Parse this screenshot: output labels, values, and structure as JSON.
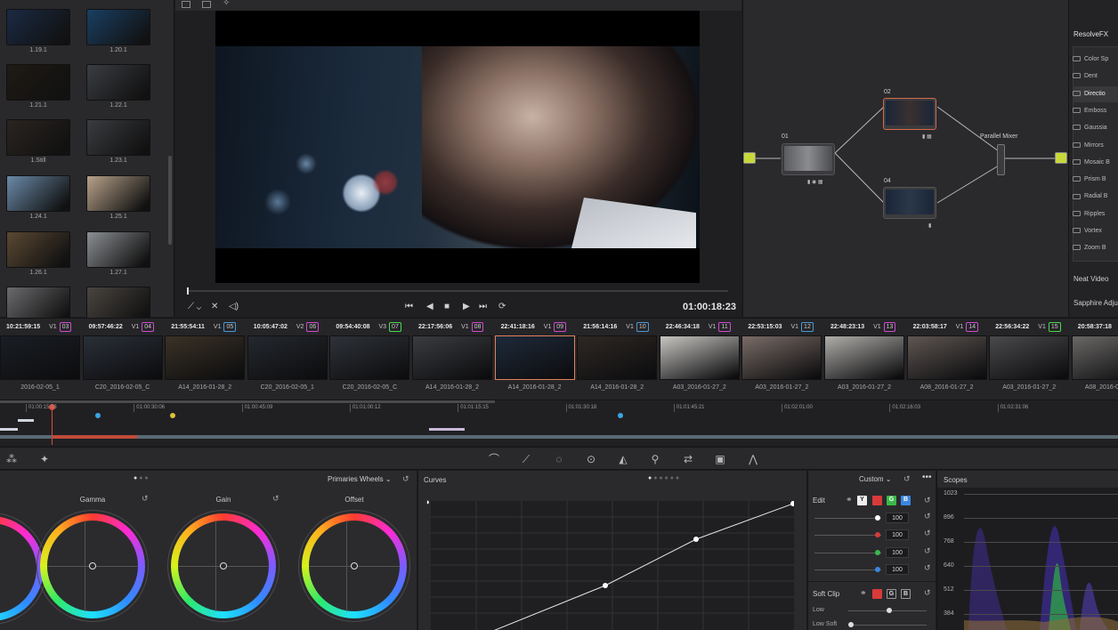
{
  "media_pool": {
    "clips": [
      {
        "label": "1.19.1",
        "color": "#1b2a44"
      },
      {
        "label": "1.20.1",
        "color": "#1a3f63"
      },
      {
        "label": "1.21.1",
        "color": "#1f1a14"
      },
      {
        "label": "1.22.1",
        "color": "#3a3d42"
      },
      {
        "label": "1.Still",
        "color": "#2a2420"
      },
      {
        "label": "1.23.1",
        "color": "#3a3c40"
      },
      {
        "label": "1.24.1",
        "color": "#6a8aa8"
      },
      {
        "label": "1.25.1",
        "color": "#b8a28a"
      },
      {
        "label": "1.26.1",
        "color": "#5a4832"
      },
      {
        "label": "1.27.1",
        "color": "#8c8f93"
      },
      {
        "label": "",
        "color": "#6b6b6e"
      },
      {
        "label": "",
        "color": "#4a4540"
      }
    ]
  },
  "viewer": {
    "timecode": "01:00:18:23"
  },
  "nodes": {
    "n01": "01",
    "n02": "02",
    "n04": "04",
    "mixer": "Parallel Mixer"
  },
  "fx": {
    "header": "ResolveFX",
    "items": [
      "Color Sp",
      "Dent",
      "Directio",
      "Emboss",
      "Gaussia",
      "Mirrors",
      "Mosaic B",
      "Prism B",
      "Radial B",
      "Ripples",
      "Vortex",
      "Zoom B"
    ],
    "footer1": "Neat Video",
    "footer2": "Sapphire Adju"
  },
  "timeline": {
    "clips": [
      {
        "tc": "10:21:59:15",
        "track": "V1",
        "num": "03",
        "numColor": "#d04bd0",
        "name": "2016-02-05_1",
        "color": "#1a1e24"
      },
      {
        "tc": "09:57:46:22",
        "track": "V1",
        "num": "04",
        "numColor": "#d04bd0",
        "name": "C20_2016-02-05_C",
        "color": "#2a2f38"
      },
      {
        "tc": "21:55:54:11",
        "track": "V1",
        "num": "05",
        "numColor": "#4a9ad8",
        "name": "A14_2016-01-28_2",
        "color": "#3a3226"
      },
      {
        "tc": "10:05:47:02",
        "track": "V2",
        "num": "06",
        "numColor": "#d04bd0",
        "name": "C20_2016-02-05_1",
        "color": "#24282e"
      },
      {
        "tc": "09:54:40:08",
        "track": "V3",
        "num": "07",
        "numColor": "#4ad84a",
        "name": "C20_2016-02-05_C",
        "color": "#2e3238"
      },
      {
        "tc": "22:17:56:06",
        "track": "V1",
        "num": "08",
        "numColor": "#d04bd0",
        "name": "A14_2016-01-28_2",
        "color": "#3a3c40"
      },
      {
        "tc": "22:41:18:16",
        "track": "V1",
        "num": "09",
        "numColor": "#d04bd0",
        "name": "A14_2016-01-28_2",
        "color": "#1e2a3a"
      },
      {
        "tc": "21:56:14:16",
        "track": "V1",
        "num": "10",
        "numColor": "#4a9ad8",
        "name": "A14_2016-01-28_2",
        "color": "#2e2824"
      },
      {
        "tc": "22:46:34:18",
        "track": "V1",
        "num": "11",
        "numColor": "#d04bd0",
        "name": "A03_2016-01-27_2",
        "color": "#c8c6c2"
      },
      {
        "tc": "22:53:15:03",
        "track": "V1",
        "num": "12",
        "numColor": "#4a9ad8",
        "name": "A03_2016-01-27_2",
        "color": "#7a6c66"
      },
      {
        "tc": "22:48:23:13",
        "track": "V1",
        "num": "13",
        "numColor": "#d04bd0",
        "name": "A03_2016-01-27_2",
        "color": "#b0aeaa"
      },
      {
        "tc": "22:03:58:17",
        "track": "V1",
        "num": "14",
        "numColor": "#d04bd0",
        "name": "A08_2016-01-27_2",
        "color": "#5e5652"
      },
      {
        "tc": "22:56:34:22",
        "track": "V1",
        "num": "15",
        "numColor": "#4ad84a",
        "name": "A03_2016-01-27_2",
        "color": "#4a4a4c"
      },
      {
        "tc": "20:58:37:18",
        "track": "",
        "num": "",
        "numColor": "#d04bd0",
        "name": "A08_2016-01-27_2",
        "color": "#6a6866"
      }
    ],
    "ruler": [
      "01:00:15:03",
      "01:00:30:06",
      "01:00:45:09",
      "01:01:00:12",
      "01:01:15:15",
      "01:01:30:18",
      "01:01:45:21",
      "01:02:01:00",
      "01:02:16:03",
      "01:02:31:06"
    ]
  },
  "wheels": {
    "mode": "Primaries Wheels",
    "gamma": "Gamma",
    "gain": "Gain",
    "offset": "Offset"
  },
  "curves": {
    "title": "Curves",
    "preset": "Custom"
  },
  "edit": {
    "label": "Edit",
    "y": "Y",
    "g": "G",
    "b": "B",
    "values": [
      "100",
      "100",
      "100",
      "100"
    ],
    "softclip": "Soft Clip",
    "low": "Low",
    "lowsoft": "Low Soft"
  },
  "scopes": {
    "title": "Scopes",
    "levels": [
      "1023",
      "896",
      "768",
      "640",
      "512",
      "384"
    ]
  }
}
